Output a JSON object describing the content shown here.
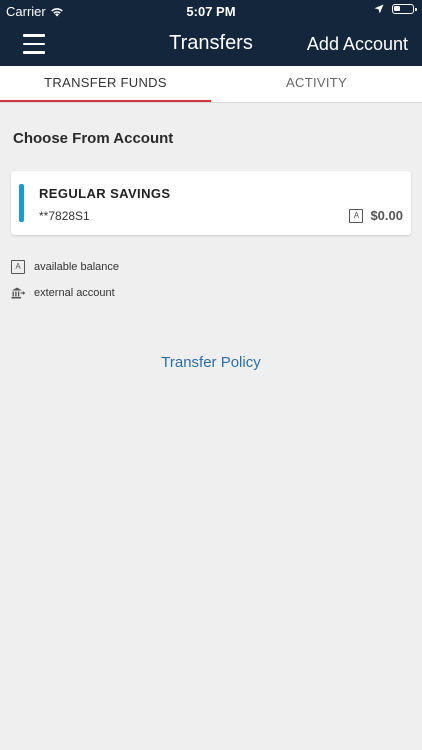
{
  "status_bar": {
    "carrier": "Carrier",
    "time": "5:07 PM"
  },
  "nav": {
    "title": "Transfers",
    "add_account_label": "Add Account"
  },
  "tabs": [
    {
      "label": "TRANSFER FUNDS",
      "active": true
    },
    {
      "label": "ACTIVITY",
      "active": false
    }
  ],
  "main": {
    "section_title": "Choose From Account",
    "accounts": [
      {
        "name": "REGULAR SAVINGS",
        "number": "**7828S1",
        "badge": "A",
        "balance": "$0.00",
        "accent_color": "#1b9ad6"
      }
    ],
    "legend": [
      {
        "icon": "available-balance-icon",
        "symbol": "A",
        "label": "available balance"
      },
      {
        "icon": "bank-icon",
        "label": "external account"
      }
    ],
    "policy_link": "Transfer Policy"
  },
  "colors": {
    "header_bg": "#13263b",
    "active_tab_underline": "#d2343a",
    "link": "#2d6ea8",
    "page_bg": "#efefef"
  }
}
